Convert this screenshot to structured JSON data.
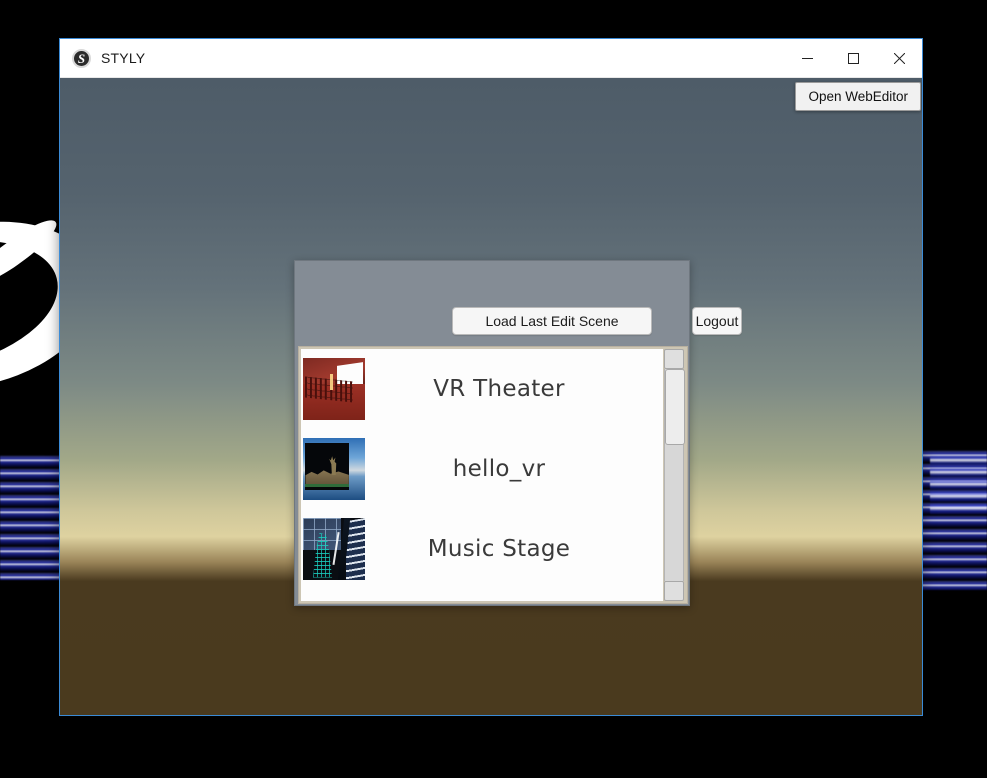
{
  "window": {
    "title": "STYLY",
    "logo_glyph": "S",
    "logo_icon_name": "styly-logo-icon",
    "controls": {
      "minimize": "minimize-icon",
      "maximize": "maximize-icon",
      "close": "close-icon"
    },
    "border_color": "#3b8bd6"
  },
  "viewport": {
    "open_webeditor_label": "Open WebEditor",
    "sky_top_color": "#4e5c68",
    "horizon_color": "#ded2a0",
    "ground_color": "#4a3a1f"
  },
  "panel": {
    "background_color": "#848c95",
    "buttons": {
      "load_last_scene": "Load Last Edit Scene",
      "logout": "Logout"
    },
    "list": {
      "frame_color": "#cdc6b4",
      "background_color": "#fdfdfd",
      "items": [
        {
          "name": "VR Theater",
          "thumb_class": "th-theater",
          "thumb_name": "thumbnail-vr-theater"
        },
        {
          "name": "hello_vr",
          "thumb_class": "th-hello",
          "thumb_name": "thumbnail-hello-vr"
        },
        {
          "name": "Music Stage",
          "thumb_class": "th-music",
          "thumb_name": "thumbnail-music-stage"
        }
      ],
      "scrollbar": {
        "up_arrow": "scroll-up-arrow",
        "down_arrow": "scroll-down-arrow",
        "thumb_position_percent": 0
      }
    }
  },
  "desktop": {
    "background_color": "#000000",
    "streak_color": "#3a48d8"
  }
}
